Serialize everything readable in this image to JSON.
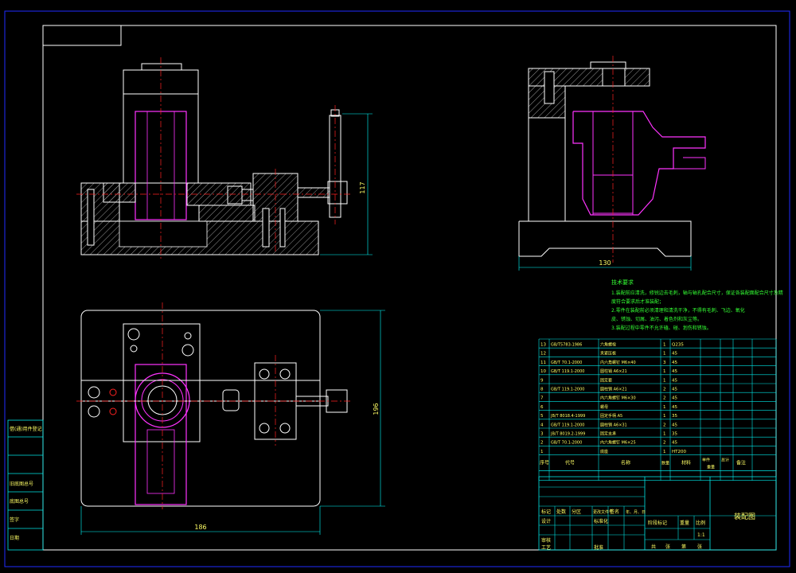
{
  "colors": {
    "background": "#000000",
    "frame_outer": "#1f2bff",
    "frame_inner": "#ffffff",
    "part_outline": "#ffffff",
    "magenta_part": "#ff33ff",
    "center_line": "#ff2222",
    "dimension": "#00ffff",
    "notes_text": "#33ff33",
    "table_line": "#00e6e6",
    "table_text": "#ffff66",
    "hatch": "#ffffff"
  },
  "dimensions": {
    "front_height": "117",
    "side_width": "130",
    "plan_height": "196",
    "plan_width": "186"
  },
  "tech_notes": {
    "title": "技术要求",
    "lines": [
      "1.装配前应清洗，修锐边去毛刺，轴与轴孔配合尺寸，保证各装配面配合尺寸及精",
      "  度符合要求后才准装配；",
      "2.零件在装配前必须清理和清洗干净，不得有毛刺、飞边、氧化",
      "  皮、锈蚀、切屑、油污、着色剂和灰尘等。",
      "3.装配过程中零件不允许磕、碰、划伤和锈蚀。"
    ]
  },
  "parts_list": {
    "rows": [
      {
        "no": "13",
        "code": "GB/T5783-1986",
        "name": "六角螺栓",
        "qty": "1",
        "mat": "Q235",
        "note": ""
      },
      {
        "no": "12",
        "code": "",
        "name": "夹紧压板",
        "qty": "1",
        "mat": "45",
        "note": ""
      },
      {
        "no": "11",
        "code": "GB/T 70.1-2000",
        "name": "内六角螺钉 M6×40",
        "qty": "3",
        "mat": "45",
        "note": ""
      },
      {
        "no": "10",
        "code": "GB/T 119.1-2000",
        "name": "圆柱销 A6×21",
        "qty": "1",
        "mat": "45",
        "note": ""
      },
      {
        "no": "9",
        "code": "",
        "name": "固定套",
        "qty": "1",
        "mat": "45",
        "note": ""
      },
      {
        "no": "8",
        "code": "GB/T 119.1-2000",
        "name": "圆柱销 A6×21",
        "qty": "2",
        "mat": "45",
        "note": ""
      },
      {
        "no": "7",
        "code": "",
        "name": "内六角螺钉 M6×30",
        "qty": "2",
        "mat": "45",
        "note": ""
      },
      {
        "no": "6",
        "code": "",
        "name": "螺母",
        "qty": "1",
        "mat": "45",
        "note": ""
      },
      {
        "no": "5",
        "code": "JB/T 8018.4-1999",
        "name": "固定手柄 A5",
        "qty": "1",
        "mat": "35",
        "note": ""
      },
      {
        "no": "4",
        "code": "GB/T 119.1-2000",
        "name": "圆柱销 A6×31",
        "qty": "2",
        "mat": "45",
        "note": ""
      },
      {
        "no": "3",
        "code": "JB/T 8019.2-1999",
        "name": "固定支承",
        "qty": "1",
        "mat": "35",
        "note": ""
      },
      {
        "no": "2",
        "code": "GB/T 70.1-2000",
        "name": "内六角螺钉 M6×25",
        "qty": "2",
        "mat": "45",
        "note": ""
      },
      {
        "no": "1",
        "code": "",
        "name": "底座",
        "qty": "1",
        "mat": "HT200",
        "note": ""
      }
    ],
    "header": {
      "no": "序号",
      "code": "代号",
      "name": "名称",
      "qty": "数量",
      "mat": "材料",
      "unit": "单件",
      "total": "总计",
      "weight": "重量",
      "note": "备注"
    }
  },
  "title_block": {
    "drawing_name": "装配图",
    "labels_row1": [
      "标记",
      "处数",
      "分区",
      "更改文件号",
      "签名",
      "年、月、日"
    ],
    "labels_row2": [
      "设计",
      "标准化"
    ],
    "labels_row3": [
      "审核"
    ],
    "labels_row4": [
      "工艺",
      "批准"
    ],
    "stage_labels": [
      "阶段标记",
      "重量",
      "比例"
    ],
    "scale": "1:1",
    "sheet": [
      "共",
      "张",
      "第",
      "张"
    ]
  },
  "side_panel": {
    "labels": [
      "借(通)用件登记",
      "旧底图总号",
      "底图总号",
      "签字",
      "日期"
    ]
  }
}
